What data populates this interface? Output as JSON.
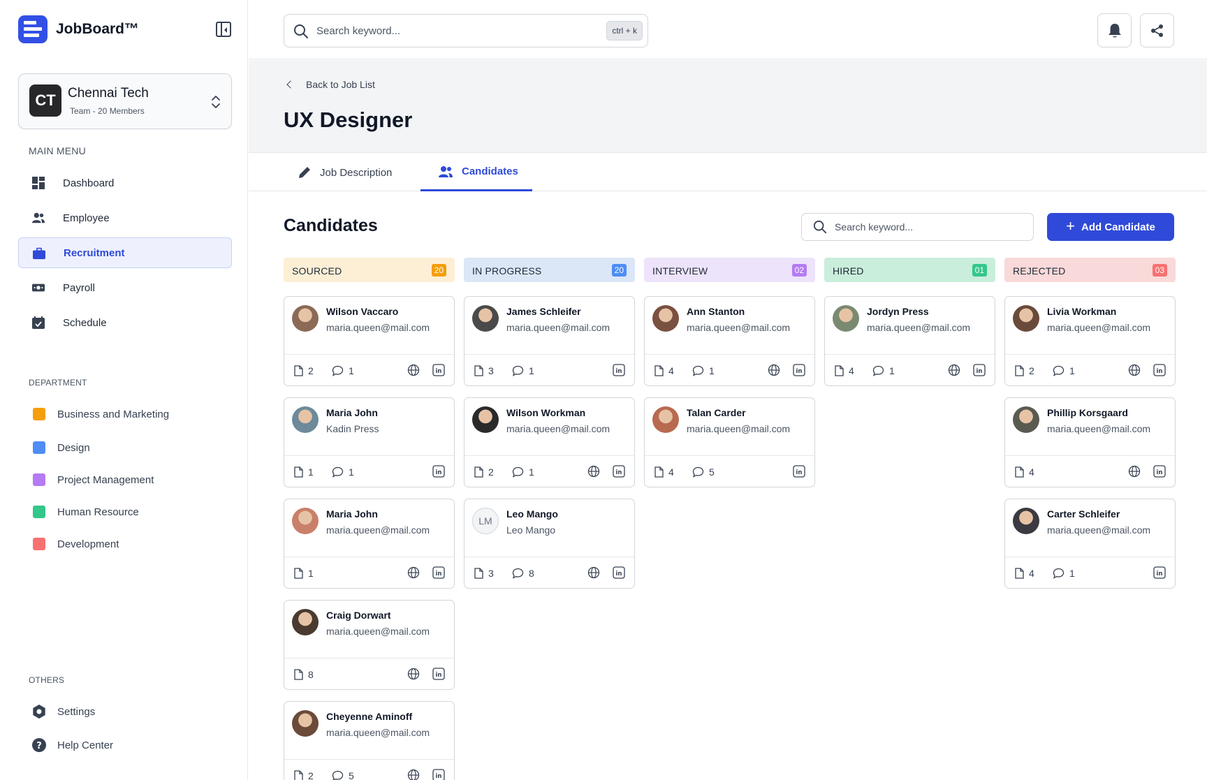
{
  "brand": {
    "name": "JobBoard™"
  },
  "org": {
    "initials": "CT",
    "name": "Chennai Tech",
    "subtitle": "Team - 20 Members"
  },
  "sidebar": {
    "main_menu_label": "MAIN MENU",
    "items": [
      {
        "label": "Dashboard",
        "icon": "dashboard-icon",
        "active": false
      },
      {
        "label": "Employee",
        "icon": "users-icon",
        "active": false
      },
      {
        "label": "Recruitment",
        "icon": "briefcase-icon",
        "active": true
      },
      {
        "label": "Payroll",
        "icon": "money-icon",
        "active": false
      },
      {
        "label": "Schedule",
        "icon": "calendar-icon",
        "active": false
      }
    ],
    "department_label": "DEPARTMENT",
    "departments": [
      {
        "label": "Business and Marketing",
        "color": "#f59e0b"
      },
      {
        "label": "Design",
        "color": "#4f8df5"
      },
      {
        "label": "Project Management",
        "color": "#b57bf3"
      },
      {
        "label": "Human Resource",
        "color": "#34c78a"
      },
      {
        "label": "Development",
        "color": "#f87171"
      }
    ],
    "others_label": "OTHERS",
    "others": [
      {
        "label": "Settings",
        "icon": "settings-icon"
      },
      {
        "label": "Help Center",
        "icon": "help-icon"
      }
    ]
  },
  "topbar": {
    "search_placeholder": "Search keyword...",
    "shortcut": "ctrl + k"
  },
  "header": {
    "back_label": "Back to Job List",
    "title": "UX Designer"
  },
  "tabs": [
    {
      "label": "Job Description",
      "icon": "pencil-icon",
      "active": false
    },
    {
      "label": "Candidates",
      "icon": "users-icon",
      "active": true
    }
  ],
  "board": {
    "title": "Candidates",
    "search_placeholder": "Search keyword...",
    "add_label": "Add Candidate",
    "columns": [
      {
        "title": "SOURCED",
        "count": "20",
        "bg": "#fdefd6",
        "badge": "#f59e0b",
        "cards": [
          {
            "name": "Wilson Vaccaro",
            "email": "maria.queen@mail.com",
            "docs": "2",
            "comments": "1",
            "web": true,
            "linkedin": true,
            "avatar": "#8b6a55"
          },
          {
            "name": "Maria John",
            "email": "Kadin Press",
            "docs": "1",
            "comments": "1",
            "web": false,
            "linkedin": true,
            "avatar": "#6d8a9a"
          },
          {
            "name": "Maria John",
            "email": "maria.queen@mail.com",
            "docs": "1",
            "comments": null,
            "web": true,
            "linkedin": true,
            "avatar": "#c9806a"
          },
          {
            "name": "Craig Dorwart",
            "email": "maria.queen@mail.com",
            "docs": "8",
            "comments": null,
            "web": true,
            "linkedin": true,
            "avatar": "#4a3a30"
          },
          {
            "name": "Cheyenne Aminoff",
            "email": "maria.queen@mail.com",
            "docs": "2",
            "comments": "5",
            "web": true,
            "linkedin": true,
            "avatar": "#6b4a3a"
          }
        ]
      },
      {
        "title": "IN PROGRESS",
        "count": "20",
        "bg": "#dbe6f7",
        "badge": "#4f8df5",
        "cards": [
          {
            "name": "James Schleifer",
            "email": "maria.queen@mail.com",
            "docs": "3",
            "comments": "1",
            "web": false,
            "linkedin": true,
            "avatar": "#4a4a4a"
          },
          {
            "name": "Wilson Workman",
            "email": "maria.queen@mail.com",
            "docs": "2",
            "comments": "1",
            "web": true,
            "linkedin": true,
            "avatar": "#2a2a2a"
          },
          {
            "name": "Leo Mango",
            "email": "Leo Mango",
            "docs": "3",
            "comments": "8",
            "web": true,
            "linkedin": true,
            "avatar": null,
            "initials": "LM"
          }
        ]
      },
      {
        "title": "INTERVIEW",
        "count": "02",
        "bg": "#ede3fb",
        "badge": "#b57bf3",
        "cards": [
          {
            "name": "Ann Stanton",
            "email": "maria.queen@mail.com",
            "docs": "4",
            "comments": "1",
            "web": true,
            "linkedin": true,
            "avatar": "#7a5040"
          },
          {
            "name": "Talan Carder",
            "email": "maria.queen@mail.com",
            "docs": "4",
            "comments": "5",
            "web": false,
            "linkedin": true,
            "avatar": "#b86a50"
          }
        ]
      },
      {
        "title": "HIRED",
        "count": "01",
        "bg": "#c9eedb",
        "badge": "#34c78a",
        "cards": [
          {
            "name": "Jordyn Press",
            "email": "maria.queen@mail.com",
            "docs": "4",
            "comments": "1",
            "web": true,
            "linkedin": true,
            "avatar": "#7a8a70"
          }
        ]
      },
      {
        "title": "REJECTED",
        "count": "03",
        "bg": "#f9d9d9",
        "badge": "#f87171",
        "cards": [
          {
            "name": "Livia Workman",
            "email": "maria.queen@mail.com",
            "docs": "2",
            "comments": "1",
            "web": true,
            "linkedin": true,
            "avatar": "#6a4a3a"
          },
          {
            "name": "Phillip Korsgaard",
            "email": "maria.queen@mail.com",
            "docs": "4",
            "comments": null,
            "web": true,
            "linkedin": true,
            "avatar": "#5a5a50"
          },
          {
            "name": "Carter Schleifer",
            "email": "maria.queen@mail.com",
            "docs": "4",
            "comments": "1",
            "web": false,
            "linkedin": true,
            "avatar": "#3a3a40"
          }
        ]
      }
    ]
  }
}
